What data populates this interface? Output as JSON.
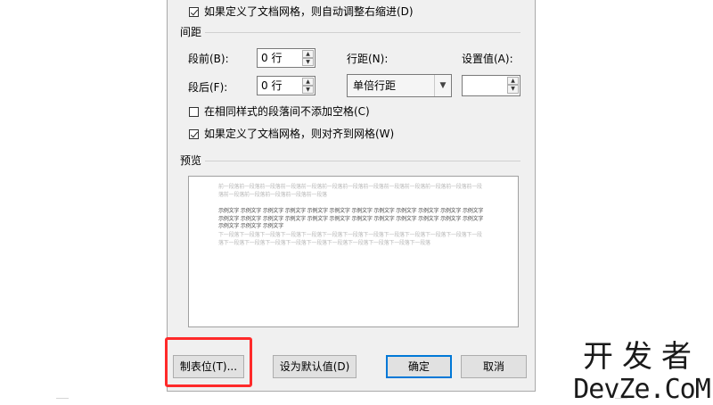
{
  "dialog": {
    "indent_grid_checkbox": {
      "label": "如果定义了文档网格，则自动调整右缩进(D)",
      "checked": true
    },
    "spacing_section": "间距",
    "before": {
      "label": "段前(B):",
      "value": "0 行"
    },
    "after": {
      "label": "段后(F):",
      "value": "0 行"
    },
    "line_spacing": {
      "label": "行距(N):",
      "value": "单倍行距"
    },
    "set_value": {
      "label": "设置值(A):",
      "value": ""
    },
    "no_space_checkbox": {
      "label": "在相同样式的段落间不添加空格(C)",
      "checked": false
    },
    "snap_grid_checkbox": {
      "label": "如果定义了文档网格，则对齐到网格(W)",
      "checked": true
    },
    "preview_section": "预览",
    "preview": {
      "prev_text": "前一段落前一段落前一段落前一段落前一段落前一段落前一段落前一段落前一段落前一段落前一段落前一段落前一段落前一段落前一段落前一段落前一段落前一段落",
      "sample_text": "示例文字 示例文字 示例文字 示例文字 示例文字 示例文字 示例文字 示例文字 示例文字 示例文字 示例文字 示例文字 示例文字 示例文字 示例文字 示例文字 示例文字 示例文字 示例文字 示例文字 示例文字 示例文字 示例文字 示例文字 示例文字 示例文字 示例文字",
      "next_text": "下一段落下一段落下一段落下一段落下一段落下一段落下一段落下一段落下一段落下一段落下一段落下一段落下一段落下一段落下一段落下一段落下一段落下一段落下一段落下一段落下一段落下一段落下一段落"
    },
    "buttons": {
      "tabs": "制表位(T)...",
      "set_default": "设为默认值(D)",
      "ok": "确定",
      "cancel": "取消"
    }
  },
  "watermark": {
    "line1": "开发者",
    "line2": "DevZe.CoM"
  },
  "colors": {
    "highlight": "#ff2a2a",
    "default_button_border": "#0078d7",
    "dialog_background": "#f0f0f0"
  }
}
